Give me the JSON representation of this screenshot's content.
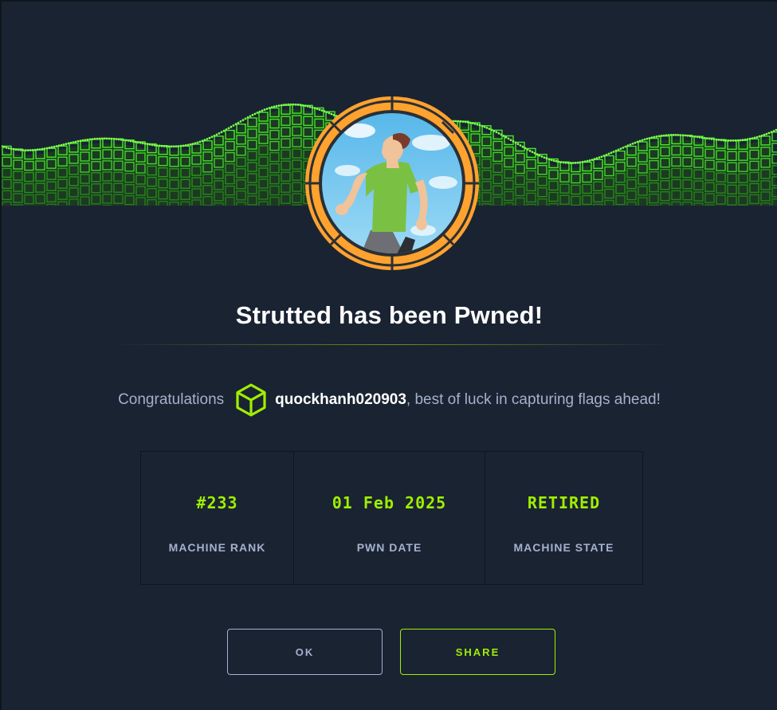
{
  "modal": {
    "title": "Strutted has been Pwned!",
    "congrats_prefix": "Congratulations",
    "username": "quockhanh020903",
    "congrats_suffix": ", best of luck in capturing flags ahead!"
  },
  "stats": [
    {
      "value": "#233",
      "label": "MACHINE RANK"
    },
    {
      "value": "01 Feb 2025",
      "label": "PWN DATE"
    },
    {
      "value": "RETIRED",
      "label": "MACHINE STATE"
    }
  ],
  "buttons": {
    "ok_label": "OK",
    "share_label": "SHARE"
  },
  "icons": {
    "user_rank": "green-cube-icon",
    "machine_avatar": "runner-avatar-icon"
  },
  "colors": {
    "accent": "#9fef00",
    "avatar_ring": "#ffa22e",
    "background": "#1a2332",
    "muted_text": "#a4b1cd"
  }
}
